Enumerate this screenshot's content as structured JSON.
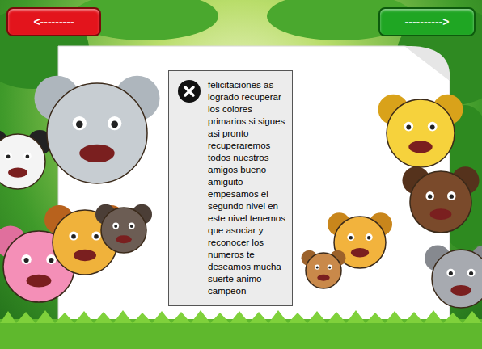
{
  "nav_buttons": [
    {
      "label": "<---------",
      "color": "#e3141c"
    },
    {
      "label": "---------->",
      "color": "#1fa623"
    }
  ],
  "dialog": {
    "message": "felicitaciones as logrado recuperar los colores primarios si sigues asi pronto recuperaremos todos nuestros amigos bueno amiguito empesamos el segundo nivel en este nivel tenemos que asociar y reconocer los numeros te deseamos mucha suerte animo campeon"
  }
}
